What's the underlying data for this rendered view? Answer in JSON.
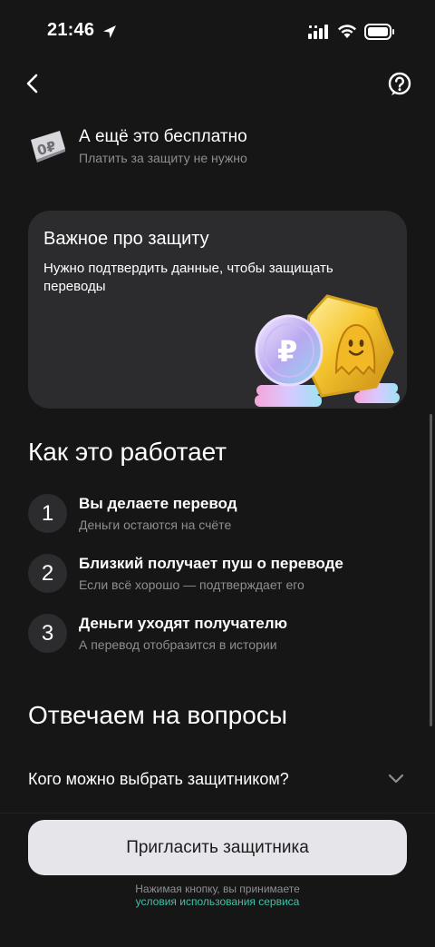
{
  "status_bar": {
    "time": "21:46"
  },
  "free": {
    "title": "А ещё это бесплатно",
    "subtitle": "Платить за защиту не нужно",
    "badge_text": "0₽"
  },
  "card": {
    "title": "Важное про защиту",
    "text": "Нужно подтвердить данные, чтобы защищать переводы"
  },
  "how": {
    "title": "Как это работает",
    "steps": [
      {
        "num": "1",
        "title": "Вы делаете перевод",
        "subtitle": "Деньги остаются на счёте"
      },
      {
        "num": "2",
        "title": "Близкий получает пуш о переводе",
        "subtitle": "Если всё хорошо — подтверждает его"
      },
      {
        "num": "3",
        "title": "Деньги уходят получателю",
        "subtitle": "А перевод отобразится в истории"
      }
    ]
  },
  "faq": {
    "title": "Отвечаем на вопросы",
    "items": [
      {
        "question": "Кого можно выбрать защитником?"
      }
    ]
  },
  "cta": {
    "label": "Пригласить защитника",
    "terms_text": "Нажимая кнопку, вы принимаете",
    "terms_link": "условия использования сервиса"
  },
  "colors": {
    "background": "#161616",
    "card": "#2c2c2e",
    "accent_link": "#3fc0a8",
    "button": "#e5e5ea"
  }
}
